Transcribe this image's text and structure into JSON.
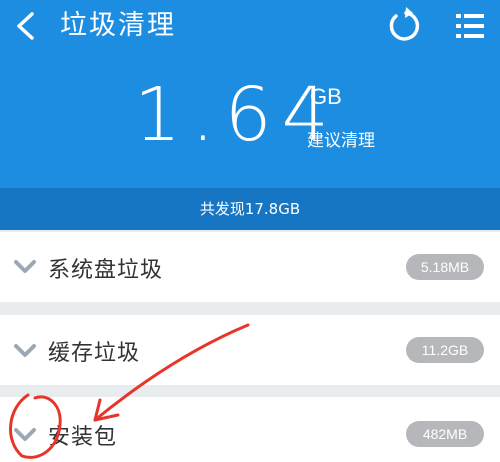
{
  "header": {
    "title": "垃圾清理",
    "back_icon": "chevron-left-icon",
    "refresh_icon": "refresh-icon",
    "menu_icon": "list-menu-icon"
  },
  "summary": {
    "value": "1.64",
    "unit": "GB",
    "suggestion": "建议清理",
    "found_text": "共发现17.8GB"
  },
  "items": [
    {
      "label": "系统盘垃圾",
      "size": "5.18MB"
    },
    {
      "label": "缓存垃圾",
      "size": "11.2GB"
    },
    {
      "label": "安装包",
      "size": "482MB"
    }
  ],
  "colors": {
    "header_bg": "#1d8de2",
    "found_band_bg": "#1676c4",
    "badge_bg": "#b5b7ba",
    "annotation": "#e8352a"
  }
}
